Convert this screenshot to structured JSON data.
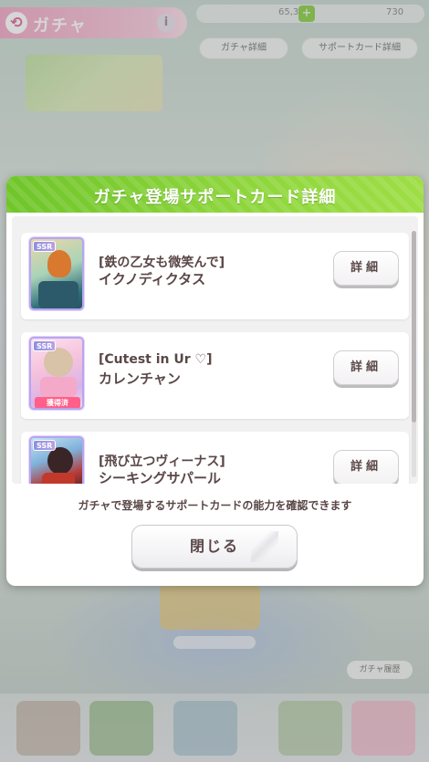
{
  "header": {
    "back_glyph": "⟲",
    "title": "ガチャ",
    "info_glyph": "i"
  },
  "currency": {
    "primary_amount": "65,350",
    "secondary_amount": "730",
    "plus_glyph": "+"
  },
  "top_buttons": {
    "gacha_detail": "ガチャ詳細",
    "support_card_detail": "サポートカード詳細"
  },
  "background": {
    "gacha_history": "ガチャ履歴"
  },
  "modal": {
    "title": "ガチャ登場サポートカード詳細",
    "note": "ガチャで登場するサポートカードの能力を確認できます",
    "close_label": "閉じる",
    "cards": [
      {
        "rarity": "SSR",
        "epithet": "[鉄の乙女も微笑んで]",
        "name": "イクノディクタス",
        "detail_label": "詳細",
        "owned": false
      },
      {
        "rarity": "SSR",
        "epithet": "[Cutest in Ur ♡]",
        "name": "カレンチャン",
        "detail_label": "詳細",
        "owned": true,
        "owned_label": "獲得済"
      },
      {
        "rarity": "SSR",
        "epithet": "[飛び立つヴィーナス]",
        "name": "シーキングサパール",
        "detail_label": "詳細",
        "owned": false
      }
    ]
  },
  "colors": {
    "header_green": "#8bd43a",
    "text_brown": "#5a4747",
    "owned_pink": "#ff5f88",
    "ssr_purple": "#9a93e3"
  }
}
